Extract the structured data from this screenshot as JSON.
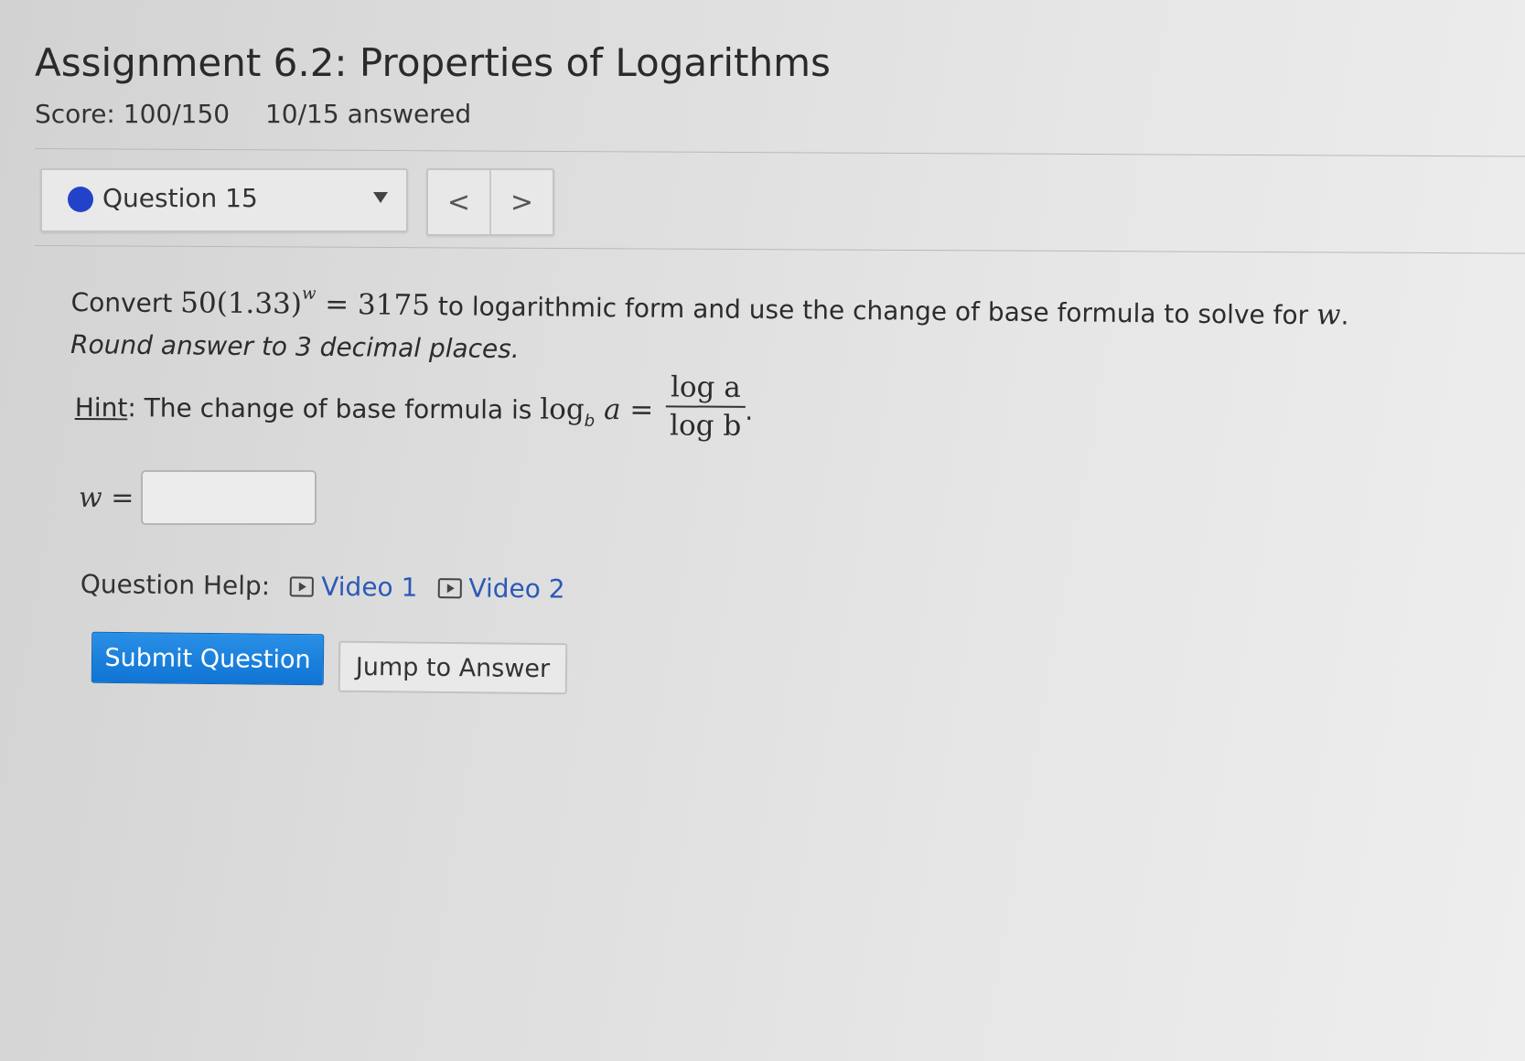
{
  "assignment": {
    "title": "Assignment 6.2: Properties of Logarithms",
    "score": "Score: 100/150",
    "answered": "10/15 answered"
  },
  "question_nav": {
    "selected_question": "Question 15",
    "prev_symbol": "<",
    "next_symbol": ">",
    "status_color": "#2243c9"
  },
  "question": {
    "prompt_prefix": "Convert ",
    "equation_base": "50(1.33)",
    "equation_exponent": "w",
    "equation_rhs": " = 3175",
    "prompt_middle": " to logarithmic form and use the change of base formula to solve for ",
    "prompt_variable": "w",
    "prompt_suffix": ". ",
    "instruction": "Round answer to 3 decimal places.",
    "hint_label": "Hint",
    "hint_text": ": The change of base formula is ",
    "hint_lhs": "log",
    "hint_lhs_sub": "b",
    "hint_lhs_arg": " a = ",
    "hint_numerator": "log a",
    "hint_denominator": "log b",
    "hint_end": "."
  },
  "answer": {
    "variable": "w =",
    "value": ""
  },
  "help": {
    "label": "Question Help:",
    "video1": "Video 1",
    "video2": "Video 2"
  },
  "actions": {
    "submit_label": "Submit Question",
    "jump_label": "Jump to Answer"
  }
}
